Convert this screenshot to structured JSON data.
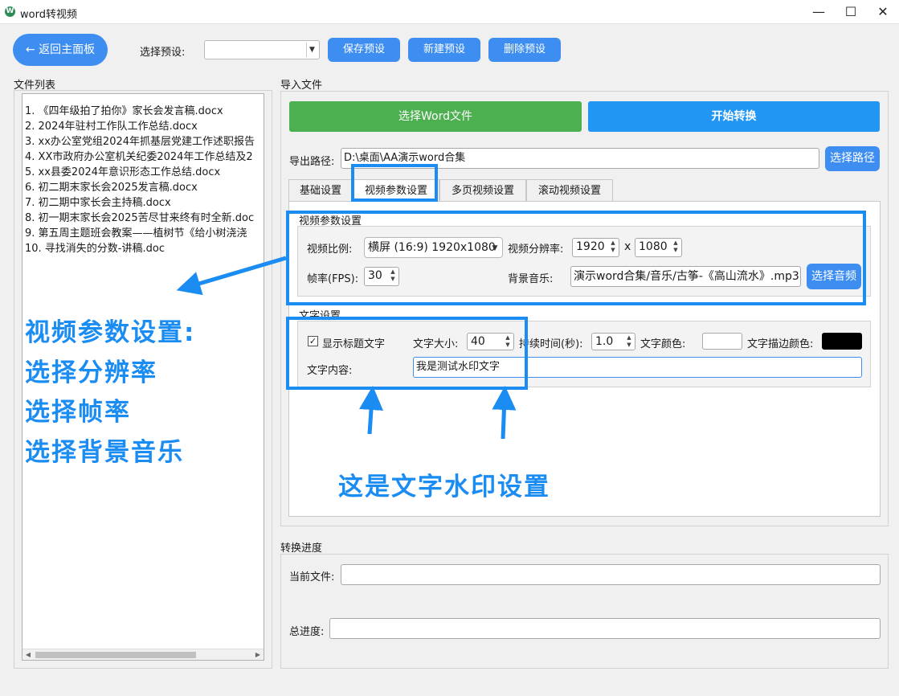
{
  "window": {
    "title": "word转视频",
    "icon": "app-icon",
    "min": "—",
    "max": "☐",
    "close": "✕"
  },
  "top": {
    "back_label": "← 返回主面板",
    "preset_label": "选择预设:",
    "preset_value": "",
    "save_preset": "保存预设",
    "new_preset": "新建预设",
    "delete_preset": "删除预设"
  },
  "file_list": {
    "title": "文件列表",
    "items": [
      "1. 《四年级拍了拍你》家长会发言稿.docx",
      "2. 2024年驻村工作队工作总结.docx",
      "3. xx办公室党组2024年抓基层党建工作述职报告",
      "4. XX市政府办公室机关纪委2024年工作总结及2",
      "5. xx县委2024年意识形态工作总结.docx",
      "6. 初二期末家长会2025发言稿.docx",
      "7. 初二期中家长会主持稿.docx",
      "8. 初一期末家长会2025苦尽甘来终有时全新.doc",
      "9. 第五周主题班会教案——植树节《给小树浇浇",
      "10. 寻找消失的分数-讲稿.doc"
    ]
  },
  "import": {
    "title": "导入文件",
    "select_word": "选择Word文件",
    "start_convert": "开始转换",
    "export_label": "导出路径:",
    "export_path": "D:\\桌面\\AA演示word合集",
    "select_path": "选择路径"
  },
  "tabs": [
    "基础设置",
    "视频参数设置",
    "多页视频设置",
    "滚动视频设置"
  ],
  "video_params": {
    "group_title": "视频参数设置",
    "ratio_label": "视频比例:",
    "ratio_value": "横屏 (16:9) 1920x1080",
    "resolution_label": "视频分辨率:",
    "width": "1920",
    "x": "x",
    "height": "1080",
    "fps_label": "帧率(FPS):",
    "fps": "30",
    "music_label": "背景音乐:",
    "music_path": "演示word合集/音乐/古筝-《高山流水》.mp3",
    "select_audio": "选择音频"
  },
  "text_settings": {
    "group_title": "文字设置",
    "show_title": "显示标题文字",
    "size_label": "文字大小:",
    "size": "40",
    "duration_label": "持续时间(秒):",
    "duration": "1.0",
    "color_label": "文字颜色:",
    "stroke_label": "文字描边颜色:",
    "content_label": "文字内容:",
    "content": "我是测试水印文字",
    "text_color": "#ffffff",
    "stroke_color": "#000000"
  },
  "progress": {
    "title": "转换进度",
    "current_label": "当前文件:",
    "total_label": "总进度:"
  },
  "annotations": {
    "left_lines": [
      "视频参数设置:",
      "选择分辨率",
      "选择帧率",
      "选择背景音乐"
    ],
    "bottom": "这是文字水印设置"
  }
}
